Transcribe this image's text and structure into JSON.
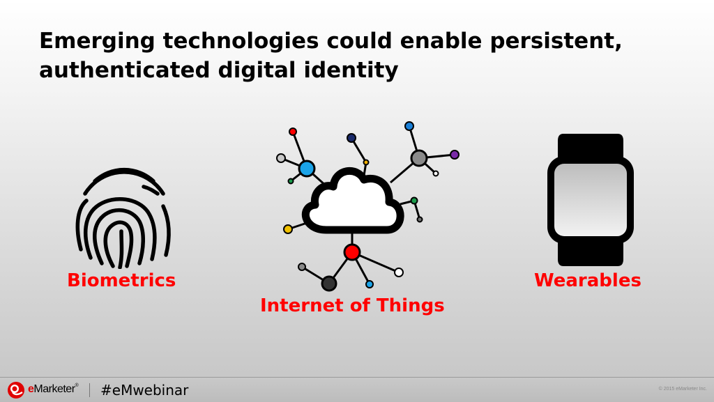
{
  "slide": {
    "title_line1": "Emerging technologies could enable persistent,",
    "title_line2": "authenticated digital identity"
  },
  "items": [
    {
      "label": "Biometrics",
      "icon": "fingerprint-icon"
    },
    {
      "label": "Internet of Things",
      "icon": "cloud-network-icon"
    },
    {
      "label": "Wearables",
      "icon": "smartwatch-icon"
    }
  ],
  "colors": {
    "accent_red": "#ff0000",
    "title": "#000000"
  },
  "footer": {
    "brand_e": "e",
    "brand_rest": "Marketer",
    "trademark": "®",
    "hashtag": "#eMwebinar",
    "copyright": "© 2015 eMarketer Inc."
  }
}
